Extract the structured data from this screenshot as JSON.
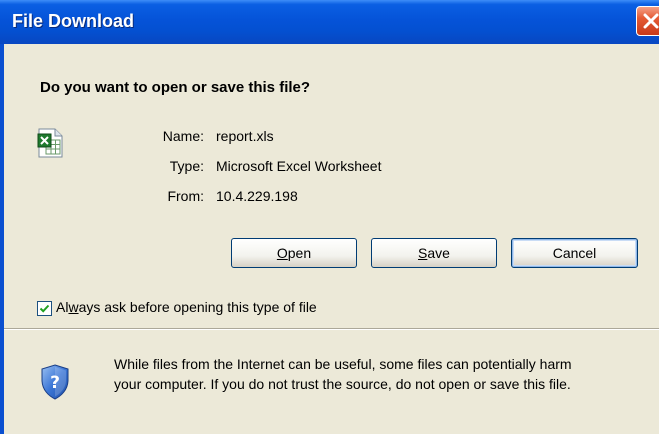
{
  "window": {
    "title": "File Download"
  },
  "dialog": {
    "question": "Do you want to open or save this file?",
    "file": {
      "name_label": "Name:",
      "name_value": "report.xls",
      "type_label": "Type:",
      "type_value": "Microsoft Excel Worksheet",
      "from_label": "From:",
      "from_value": "10.4.229.198",
      "icon": "excel-file-icon"
    },
    "buttons": {
      "open_pre": "",
      "open_mnemonic": "O",
      "open_post": "pen",
      "save_pre": "",
      "save_mnemonic": "S",
      "save_post": "ave",
      "cancel": "Cancel"
    },
    "checkbox": {
      "checked": true,
      "label_pre": "Al",
      "label_mnemonic": "w",
      "label_post": "ays ask before opening this type of file"
    },
    "warning": {
      "line1": "While files from the Internet can be useful, some files can potentially harm",
      "line2": "your computer. If you do not trust the source, do not open or save this file.",
      "icon": "security-shield-icon"
    }
  }
}
